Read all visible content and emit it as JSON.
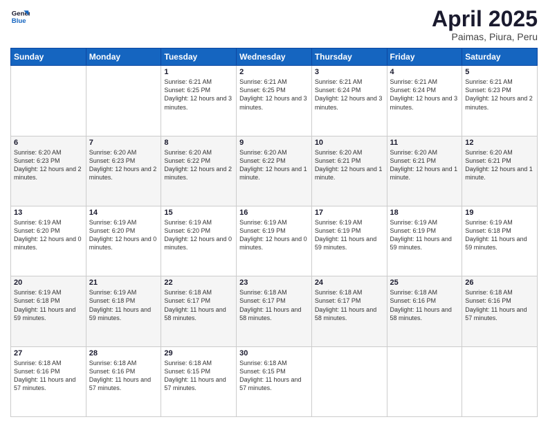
{
  "header": {
    "logo_line1": "General",
    "logo_line2": "Blue",
    "title": "April 2025",
    "subtitle": "Paimas, Piura, Peru"
  },
  "weekdays": [
    "Sunday",
    "Monday",
    "Tuesday",
    "Wednesday",
    "Thursday",
    "Friday",
    "Saturday"
  ],
  "weeks": [
    [
      {
        "day": "",
        "info": ""
      },
      {
        "day": "",
        "info": ""
      },
      {
        "day": "1",
        "info": "Sunrise: 6:21 AM\nSunset: 6:25 PM\nDaylight: 12 hours and 3 minutes."
      },
      {
        "day": "2",
        "info": "Sunrise: 6:21 AM\nSunset: 6:25 PM\nDaylight: 12 hours and 3 minutes."
      },
      {
        "day": "3",
        "info": "Sunrise: 6:21 AM\nSunset: 6:24 PM\nDaylight: 12 hours and 3 minutes."
      },
      {
        "day": "4",
        "info": "Sunrise: 6:21 AM\nSunset: 6:24 PM\nDaylight: 12 hours and 3 minutes."
      },
      {
        "day": "5",
        "info": "Sunrise: 6:21 AM\nSunset: 6:23 PM\nDaylight: 12 hours and 2 minutes."
      }
    ],
    [
      {
        "day": "6",
        "info": "Sunrise: 6:20 AM\nSunset: 6:23 PM\nDaylight: 12 hours and 2 minutes."
      },
      {
        "day": "7",
        "info": "Sunrise: 6:20 AM\nSunset: 6:23 PM\nDaylight: 12 hours and 2 minutes."
      },
      {
        "day": "8",
        "info": "Sunrise: 6:20 AM\nSunset: 6:22 PM\nDaylight: 12 hours and 2 minutes."
      },
      {
        "day": "9",
        "info": "Sunrise: 6:20 AM\nSunset: 6:22 PM\nDaylight: 12 hours and 1 minute."
      },
      {
        "day": "10",
        "info": "Sunrise: 6:20 AM\nSunset: 6:21 PM\nDaylight: 12 hours and 1 minute."
      },
      {
        "day": "11",
        "info": "Sunrise: 6:20 AM\nSunset: 6:21 PM\nDaylight: 12 hours and 1 minute."
      },
      {
        "day": "12",
        "info": "Sunrise: 6:20 AM\nSunset: 6:21 PM\nDaylight: 12 hours and 1 minute."
      }
    ],
    [
      {
        "day": "13",
        "info": "Sunrise: 6:19 AM\nSunset: 6:20 PM\nDaylight: 12 hours and 0 minutes."
      },
      {
        "day": "14",
        "info": "Sunrise: 6:19 AM\nSunset: 6:20 PM\nDaylight: 12 hours and 0 minutes."
      },
      {
        "day": "15",
        "info": "Sunrise: 6:19 AM\nSunset: 6:20 PM\nDaylight: 12 hours and 0 minutes."
      },
      {
        "day": "16",
        "info": "Sunrise: 6:19 AM\nSunset: 6:19 PM\nDaylight: 12 hours and 0 minutes."
      },
      {
        "day": "17",
        "info": "Sunrise: 6:19 AM\nSunset: 6:19 PM\nDaylight: 11 hours and 59 minutes."
      },
      {
        "day": "18",
        "info": "Sunrise: 6:19 AM\nSunset: 6:19 PM\nDaylight: 11 hours and 59 minutes."
      },
      {
        "day": "19",
        "info": "Sunrise: 6:19 AM\nSunset: 6:18 PM\nDaylight: 11 hours and 59 minutes."
      }
    ],
    [
      {
        "day": "20",
        "info": "Sunrise: 6:19 AM\nSunset: 6:18 PM\nDaylight: 11 hours and 59 minutes."
      },
      {
        "day": "21",
        "info": "Sunrise: 6:19 AM\nSunset: 6:18 PM\nDaylight: 11 hours and 59 minutes."
      },
      {
        "day": "22",
        "info": "Sunrise: 6:18 AM\nSunset: 6:17 PM\nDaylight: 11 hours and 58 minutes."
      },
      {
        "day": "23",
        "info": "Sunrise: 6:18 AM\nSunset: 6:17 PM\nDaylight: 11 hours and 58 minutes."
      },
      {
        "day": "24",
        "info": "Sunrise: 6:18 AM\nSunset: 6:17 PM\nDaylight: 11 hours and 58 minutes."
      },
      {
        "day": "25",
        "info": "Sunrise: 6:18 AM\nSunset: 6:16 PM\nDaylight: 11 hours and 58 minutes."
      },
      {
        "day": "26",
        "info": "Sunrise: 6:18 AM\nSunset: 6:16 PM\nDaylight: 11 hours and 57 minutes."
      }
    ],
    [
      {
        "day": "27",
        "info": "Sunrise: 6:18 AM\nSunset: 6:16 PM\nDaylight: 11 hours and 57 minutes."
      },
      {
        "day": "28",
        "info": "Sunrise: 6:18 AM\nSunset: 6:16 PM\nDaylight: 11 hours and 57 minutes."
      },
      {
        "day": "29",
        "info": "Sunrise: 6:18 AM\nSunset: 6:15 PM\nDaylight: 11 hours and 57 minutes."
      },
      {
        "day": "30",
        "info": "Sunrise: 6:18 AM\nSunset: 6:15 PM\nDaylight: 11 hours and 57 minutes."
      },
      {
        "day": "",
        "info": ""
      },
      {
        "day": "",
        "info": ""
      },
      {
        "day": "",
        "info": ""
      }
    ]
  ]
}
